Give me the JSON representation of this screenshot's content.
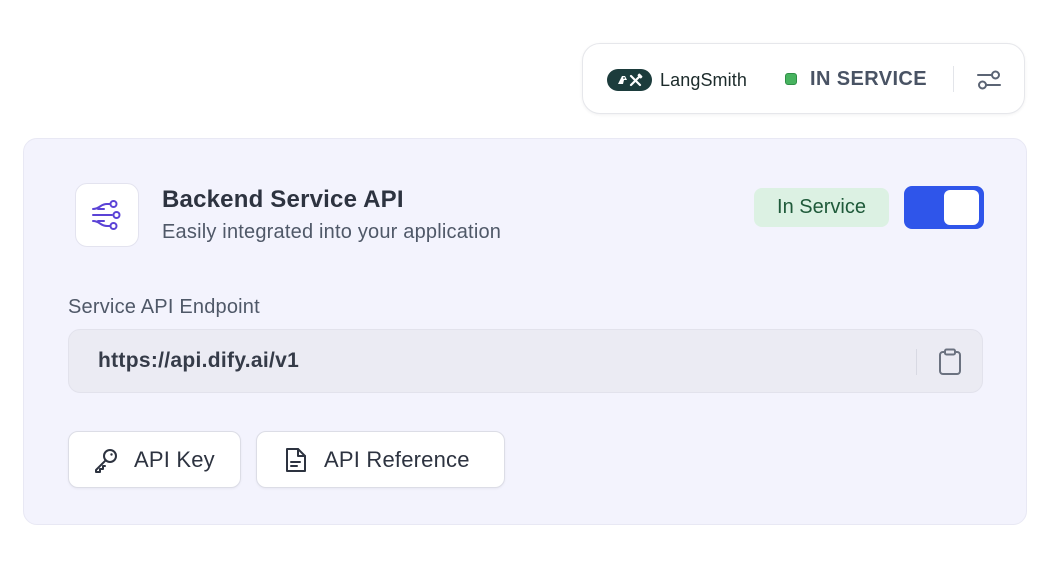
{
  "tracing": {
    "provider_name": "LangSmith",
    "provider_icon": "langsmith-logo",
    "status_text": "IN SERVICE",
    "status_color": "#47b35f",
    "settings_icon": "settings-sliders-icon"
  },
  "service_card": {
    "icon": "api-connection-icon",
    "title": "Backend Service API",
    "subtitle": "Easily integrated into your application",
    "status_badge": "In Service",
    "toggle_on": true,
    "accent_color": "#2f55ea",
    "endpoint": {
      "label": "Service API Endpoint",
      "value": "https://api.dify.ai/v1",
      "copy_icon": "clipboard-icon"
    },
    "buttons": {
      "api_key_label": "API Key",
      "api_key_icon": "key-icon",
      "api_reference_label": "API Reference",
      "api_reference_icon": "document-icon"
    }
  }
}
